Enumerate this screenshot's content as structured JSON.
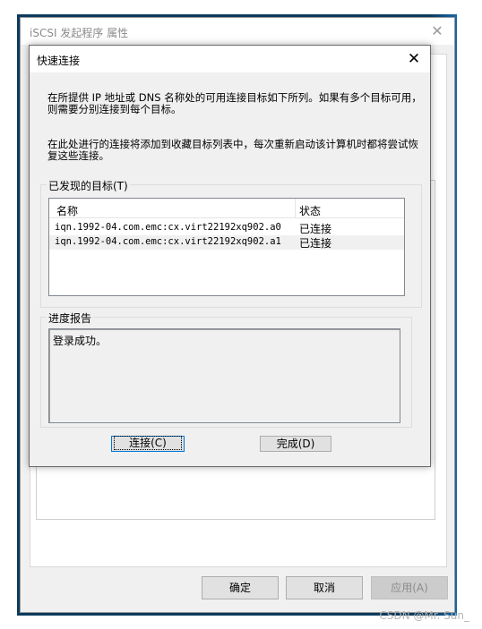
{
  "parent_window": {
    "title": "iSCSI 发起程序 属性",
    "close_glyph": "✕",
    "buttons": {
      "ok": "确定",
      "cancel": "取消",
      "apply": "应用(A)"
    }
  },
  "dialog": {
    "title": "快速连接",
    "close_glyph": "✕",
    "description_1": "在所提供 IP 地址或 DNS 名称处的可用连接目标如下所列。如果有多个目标可用，则需要分别连接到每个目标。",
    "description_2": "在此处进行的连接将添加到收藏目标列表中，每次重新启动该计算机时都将尝试恢复这些连接。",
    "discovered_targets": {
      "label": "已发现的目标(T)",
      "columns": {
        "name": "名称",
        "status": "状态"
      },
      "rows": [
        {
          "name": "iqn.1992-04.com.emc:cx.virt22192xq902.a0",
          "status": "已连接"
        },
        {
          "name": "iqn.1992-04.com.emc:cx.virt22192xq902.a1",
          "status": "已连接"
        }
      ]
    },
    "progress_report": {
      "label": "进度报告",
      "text": "登录成功。"
    },
    "buttons": {
      "connect": "连接(C)",
      "done": "完成(D)"
    }
  },
  "watermark": "CSDN @Mr. Sun_"
}
